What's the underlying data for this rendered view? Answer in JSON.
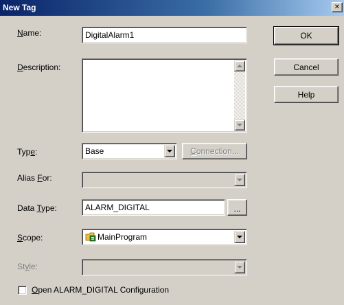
{
  "window": {
    "title": "New Tag",
    "close_glyph": "✕"
  },
  "form": {
    "name": {
      "label_pre": "",
      "label_key": "N",
      "label_post": "ame:",
      "value": "DigitalAlarm1"
    },
    "description": {
      "label_pre": "",
      "label_key": "D",
      "label_post": "escription:",
      "value": ""
    },
    "type": {
      "label_pre": "Typ",
      "label_key": "e",
      "label_post": ":",
      "value": "Base"
    },
    "connection_button": {
      "label_pre": "",
      "label_key": "C",
      "label_post": "onnection..."
    },
    "alias_for": {
      "label_pre": "Alias ",
      "label_key": "F",
      "label_post": "or:",
      "value": ""
    },
    "data_type": {
      "label_pre": "Data ",
      "label_key": "T",
      "label_post": "ype:",
      "value": "ALARM_DIGITAL",
      "browse_label": "..."
    },
    "scope": {
      "label_pre": "",
      "label_key": "S",
      "label_post": "cope:",
      "value": "MainProgram",
      "icon": "program-folder-icon"
    },
    "style": {
      "label_pre": "St",
      "label_key": "y",
      "label_post": "le:",
      "value": ""
    },
    "open_config": {
      "label_pre": "",
      "label_key": "O",
      "label_post": "pen ALARM_DIGITAL Configuration",
      "checked": false
    }
  },
  "buttons": {
    "ok": "OK",
    "cancel": "Cancel",
    "help": "Help"
  }
}
